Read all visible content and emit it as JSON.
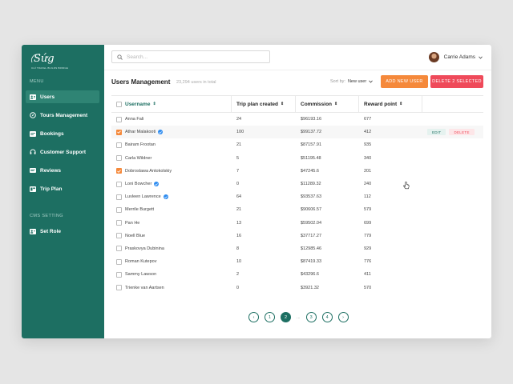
{
  "brand": {
    "logo_text": "Sứg",
    "tagline": "CHỈ TRAVEL BUILDS BRIDGE"
  },
  "sidebar": {
    "menu_label": "MENU",
    "items": [
      {
        "label": "Users",
        "icon": "users-icon",
        "active": true
      },
      {
        "label": "Tours Management",
        "icon": "compass-icon"
      },
      {
        "label": "Bookings",
        "icon": "bookings-icon"
      },
      {
        "label": "Customer Support",
        "icon": "headset-icon"
      },
      {
        "label": "Reviews",
        "icon": "reviews-icon"
      },
      {
        "label": "Trip Plan",
        "icon": "trip-plan-icon"
      }
    ],
    "cms_label": "CMS SETTING",
    "cms_items": [
      {
        "label": "Set Role",
        "icon": "set-role-icon"
      }
    ]
  },
  "topbar": {
    "search_placeholder": "Search...",
    "user_name": "Carrie Adams"
  },
  "header": {
    "title": "Users Management",
    "total": "23,294 users in total",
    "sort_label": "Sort by:",
    "sort_value": "New user",
    "add_button": "ADD NEW USER",
    "delete_button": "DELETE 2 SELECTED"
  },
  "table": {
    "columns": [
      "Username",
      "Trip plan created",
      "Commission",
      "Reward point"
    ],
    "rows": [
      {
        "name": "Anna Fali",
        "trips": "24",
        "commission": "$96193.16",
        "reward": "677",
        "checked": false,
        "verified": false
      },
      {
        "name": "Athar Malakooti",
        "trips": "100",
        "commission": "$99137.72",
        "reward": "412",
        "checked": true,
        "verified": true
      },
      {
        "name": "Bairam Frootan",
        "trips": "21",
        "commission": "$87157.91",
        "reward": "935",
        "checked": false,
        "verified": false
      },
      {
        "name": "Carla Wildner",
        "trips": "5",
        "commission": "$51195.48",
        "reward": "340",
        "checked": false,
        "verified": false
      },
      {
        "name": "Dobroslawa Antokolskiy",
        "trips": "7",
        "commission": "$47245.6",
        "reward": "201",
        "checked": true,
        "verified": false
      },
      {
        "name": "Loni Bowcher",
        "trips": "0",
        "commission": "$11289.32",
        "reward": "240",
        "checked": false,
        "verified": true
      },
      {
        "name": "Luvleen Lawrence",
        "trips": "64",
        "commission": "$93537.63",
        "reward": "112",
        "checked": false,
        "verified": true
      },
      {
        "name": "Merrile Burgett",
        "trips": "21",
        "commission": "$90606.57",
        "reward": "579",
        "checked": false,
        "verified": false
      },
      {
        "name": "Pan He",
        "trips": "13",
        "commission": "$59502.04",
        "reward": "699",
        "checked": false,
        "verified": false
      },
      {
        "name": "Noell Blue",
        "trips": "16",
        "commission": "$37717.27",
        "reward": "779",
        "checked": false,
        "verified": false
      },
      {
        "name": "Praskovya Dubinina",
        "trips": "8",
        "commission": "$12985.46",
        "reward": "929",
        "checked": false,
        "verified": false
      },
      {
        "name": "Roman Kutepov",
        "trips": "10",
        "commission": "$87419.33",
        "reward": "776",
        "checked": false,
        "verified": false
      },
      {
        "name": "Sammy Lawson",
        "trips": "2",
        "commission": "$43296.6",
        "reward": "411",
        "checked": false,
        "verified": false
      },
      {
        "name": "Trienke van Aartsen",
        "trips": "0",
        "commission": "$3921.32",
        "reward": "570",
        "checked": false,
        "verified": false
      }
    ],
    "row_actions": {
      "edit": "EDIT",
      "delete": "DELETE"
    },
    "highlight_row": 1
  },
  "pagination": {
    "pages": [
      "1",
      "2",
      "3",
      "4"
    ],
    "active": "2",
    "ellipsis": "..."
  },
  "colors": {
    "primary": "#1d6f62",
    "accent_orange": "#f5893b",
    "accent_red": "#ef4a5a",
    "verified_blue": "#2e8cf0"
  }
}
